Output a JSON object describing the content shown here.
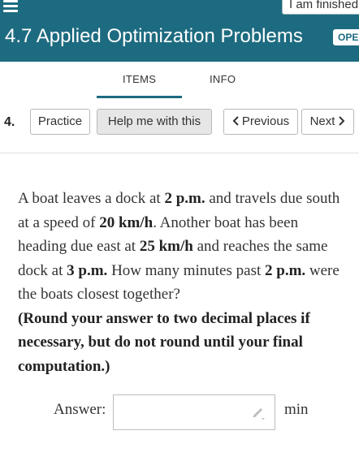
{
  "header": {
    "finished_button": "I am finished",
    "title": "4.7 Applied Optimization Problems",
    "badge": "OPEN"
  },
  "tabs": [
    "ITEMS",
    "INFO"
  ],
  "nav": {
    "question_number": "4.",
    "practice": "Practice",
    "help": "Help me with this",
    "previous": "Previous",
    "next": "Next"
  },
  "question": {
    "p1": "A boat leaves a dock at ",
    "t1": "2 p.m.",
    "p2": " and travels due south at a speed of ",
    "t2": "20 km/h",
    "p3": ". Another boat has been heading due east at ",
    "t3": "25 km/h",
    "p4": " and reaches the same dock at ",
    "t4": "3 p.m.",
    "p5": " How many minutes past ",
    "t5": "2 p.m.",
    "p6": " were the boats closest together?",
    "instruction": "(Round your answer to two decimal places if necessary, but do not round until your final computation.)"
  },
  "answer": {
    "label": "Answer:",
    "value": "",
    "unit": "min"
  },
  "icons": [
    "menu-icon",
    "chevron-left-icon",
    "chevron-right-icon",
    "pencil-icon"
  ]
}
